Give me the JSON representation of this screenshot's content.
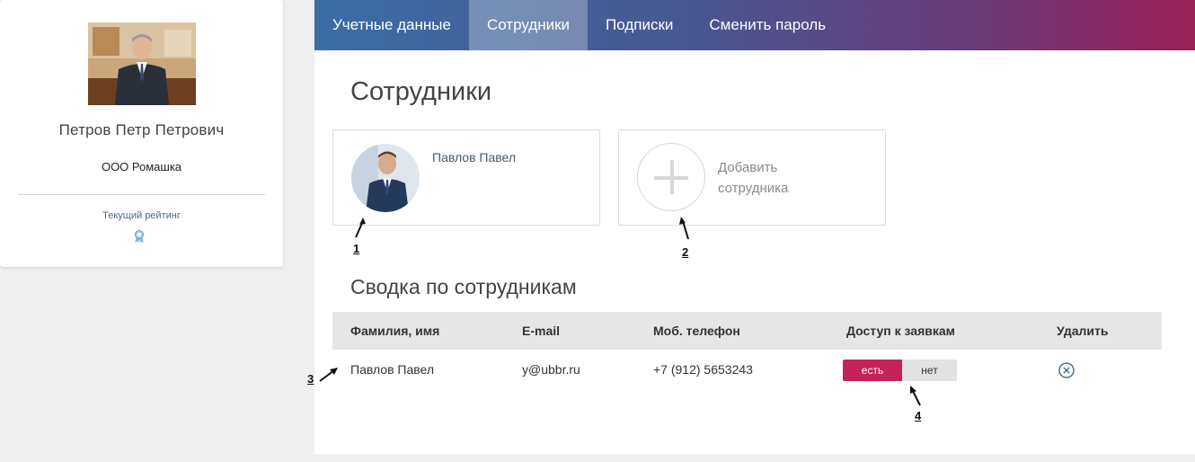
{
  "profile": {
    "name": "Петров Петр Петрович",
    "company": "ООО Ромашка",
    "rating_label": "Текущий рейтинг"
  },
  "tabs": [
    {
      "label": "Учетные данные",
      "active": false
    },
    {
      "label": "Сотрудники",
      "active": true
    },
    {
      "label": "Подписки",
      "active": false
    },
    {
      "label": "Сменить пароль",
      "active": false
    }
  ],
  "page_title": "Сотрудники",
  "employee_card": {
    "name": "Павлов Павел"
  },
  "add_card": {
    "label_line1": "Добавить",
    "label_line2": "сотрудника"
  },
  "summary": {
    "title": "Сводка по сотрудникам",
    "columns": [
      "Фамилия, имя",
      "E-mail",
      "Моб. телефон",
      "Доступ к заявкам",
      "Удалить"
    ],
    "rows": [
      {
        "name": "Павлов Павел",
        "email": "y@ubbr.ru",
        "phone": "+7 (912) 5653243",
        "access_on": "есть",
        "access_off": "нет"
      }
    ]
  },
  "markers": [
    "1",
    "2",
    "3",
    "4"
  ],
  "colors": {
    "accent_pink": "#c5225c",
    "tab_gradient_start": "#3a6ea5",
    "tab_gradient_end": "#9b2055"
  }
}
